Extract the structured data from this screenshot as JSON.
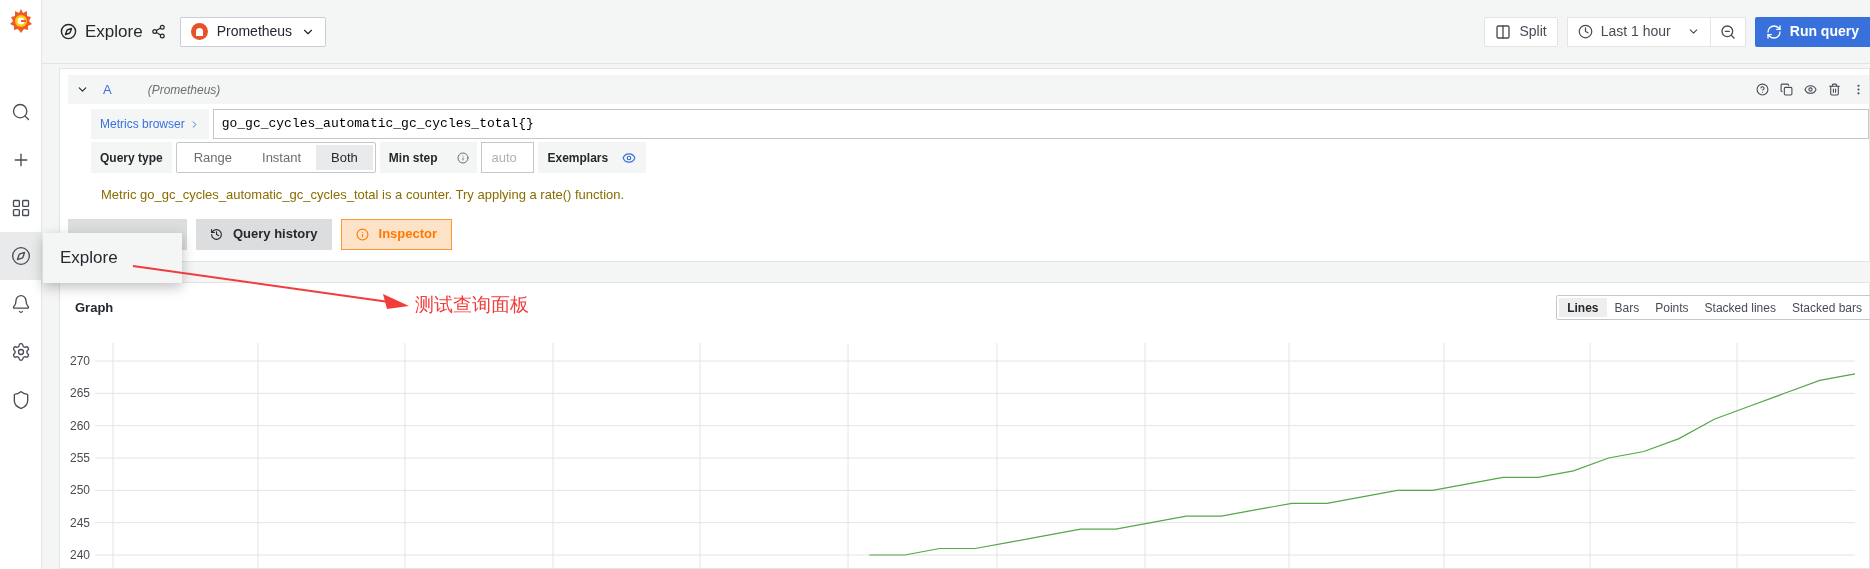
{
  "sidebar": {
    "items": [
      {
        "kind": "search",
        "selected": false
      },
      {
        "kind": "create",
        "selected": false
      },
      {
        "kind": "dashboards",
        "selected": false
      },
      {
        "kind": "explore",
        "selected": true
      },
      {
        "kind": "alerting",
        "selected": false
      },
      {
        "kind": "settings",
        "selected": false
      },
      {
        "kind": "admin",
        "selected": false
      }
    ]
  },
  "tooltip": {
    "text": "Explore"
  },
  "toolbar": {
    "title": "Explore",
    "datasource": "Prometheus",
    "split": "Split",
    "time_range": "Last 1 hour",
    "run_button": "Run query"
  },
  "query": {
    "ref": "A",
    "datasource": "(Prometheus)",
    "expanded": true,
    "metrics_browser": "Metrics browser",
    "expression": "go_gc_cycles_automatic_gc_cycles_total{}",
    "query_type_label": "Query type",
    "query_types": [
      {
        "label": "Range",
        "selected": false
      },
      {
        "label": "Instant",
        "selected": false
      },
      {
        "label": "Both",
        "selected": true
      }
    ],
    "min_step_label": "Min step",
    "min_step_placeholder": "auto",
    "exemplars_label": "Exemplars",
    "exemplars_on": true,
    "warning": "Metric go_gc_cycles_automatic_gc_cycles_total is a counter. Try applying a rate() function."
  },
  "actions": [
    {
      "kind": "add",
      "selected": false
    },
    {
      "kind": "history",
      "label": "Query history",
      "selected": false
    },
    {
      "kind": "inspector",
      "label": "Inspector",
      "selected": true
    }
  ],
  "annotation": {
    "text": "测试查询面板"
  },
  "graph": {
    "title": "Graph",
    "modes": [
      {
        "label": "Lines",
        "selected": true
      },
      {
        "label": "Bars",
        "selected": false
      },
      {
        "label": "Points",
        "selected": false
      },
      {
        "label": "Stacked lines",
        "selected": false
      },
      {
        "label": "Stacked bars",
        "selected": false
      }
    ],
    "chart_data": {
      "type": "line",
      "grid": true,
      "ylim": [
        240,
        270
      ],
      "yticks": [
        240,
        245,
        250,
        255,
        260,
        265,
        270
      ],
      "series": [
        {
          "color": "#56a64b",
          "values": [
            null,
            null,
            null,
            null,
            null,
            null,
            null,
            null,
            null,
            null,
            null,
            null,
            null,
            null,
            null,
            null,
            null,
            null,
            null,
            null,
            null,
            null,
            240,
            240,
            241,
            241,
            242,
            243,
            244,
            244,
            245,
            246,
            246,
            247,
            248,
            248,
            249,
            250,
            250,
            251,
            252,
            252,
            253,
            255,
            256,
            258,
            261,
            263,
            265,
            267,
            268
          ]
        }
      ]
    }
  }
}
